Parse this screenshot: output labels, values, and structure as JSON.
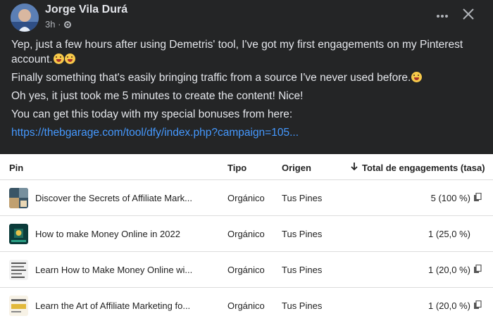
{
  "post": {
    "author": "Jorge Vila Durá",
    "time": "3h ·",
    "paragraphs": [
      "Yep, just a few hours after using Demetris' tool, I've got my first engagements on my Pinterest account.",
      "Finally something that's easily bringing traffic from a source I've never used before.",
      "Oh yes, it just took me 5 minutes to create the content! Nice!",
      "You can get this today with my special bonuses from here:"
    ],
    "link": "https://thebgarage.com/tool/dfy/index.php?campaign=105...",
    "more_icon": "more-horizontal-icon",
    "close_icon": "close-icon"
  },
  "table": {
    "headers": {
      "pin": "Pin",
      "tipo": "Tipo",
      "origen": "Origen",
      "engagements": "Total de engagements (tasa)"
    },
    "sort_icon": "arrow-down-icon",
    "rows": [
      {
        "title": "Discover the Secrets of Affiliate Mark...",
        "tipo": "Orgánico",
        "origen": "Tus Pines",
        "engagements": "5 (100 %)"
      },
      {
        "title": "How to make Money Online in 2022",
        "tipo": "Orgánico",
        "origen": "Tus Pines",
        "engagements": "1 (25,0 %)"
      },
      {
        "title": "Learn How to Make Money Online wi...",
        "tipo": "Orgánico",
        "origen": "Tus Pines",
        "engagements": "1 (20,0 %)"
      },
      {
        "title": "Learn the Art of Affiliate Marketing fo...",
        "tipo": "Orgánico",
        "origen": "Tus Pines",
        "engagements": "1 (20,0 %)"
      }
    ]
  }
}
